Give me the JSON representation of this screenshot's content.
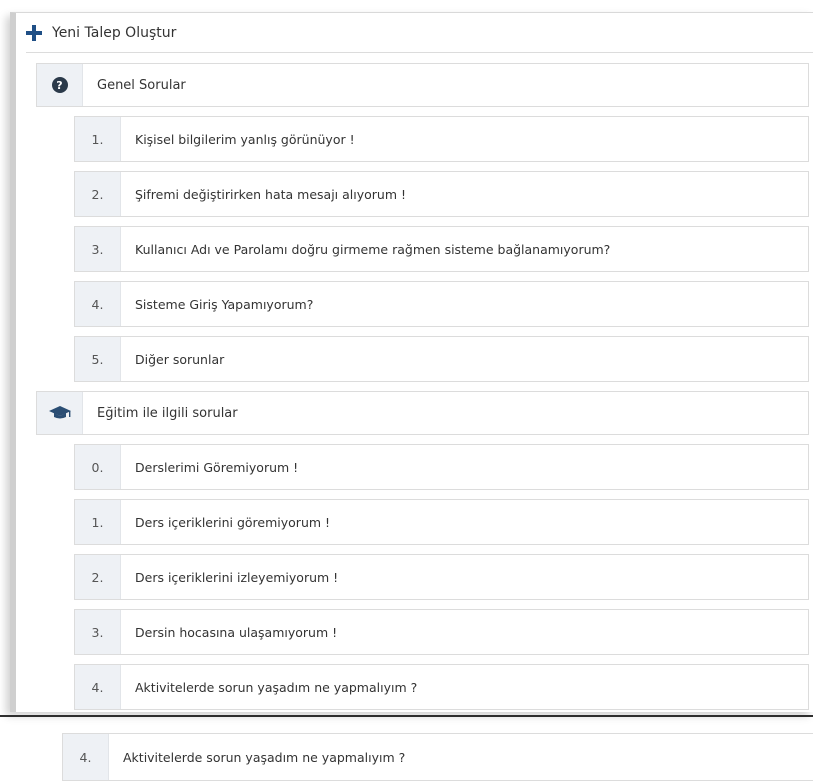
{
  "header": {
    "new_request_label": "Yeni Talep Oluştur"
  },
  "categories": [
    {
      "icon": "question-circle-icon",
      "title": "Genel Sorular",
      "items": [
        {
          "num": "1.",
          "text": "Kişisel bilgilerim yanlış görünüyor !"
        },
        {
          "num": "2.",
          "text": "Şifremi değiştirirken hata mesajı alıyorum !"
        },
        {
          "num": "3.",
          "text": "Kullanıcı Adı ve Parolamı doğru girmeme rağmen sisteme bağlanamıyorum?"
        },
        {
          "num": "4.",
          "text": "Sisteme Giriş Yapamıyorum?"
        },
        {
          "num": "5.",
          "text": "Diğer sorunlar"
        }
      ]
    },
    {
      "icon": "graduation-cap-icon",
      "title": "Eğitim ile ilgili sorular",
      "items": [
        {
          "num": "0.",
          "text": "Derslerimi Göremiyorum !"
        },
        {
          "num": "1.",
          "text": "Ders içeriklerini göremiyorum !"
        },
        {
          "num": "2.",
          "text": "Ders içeriklerini izleyemiyorum !"
        },
        {
          "num": "3.",
          "text": "Dersin hocasına ulaşamıyorum !"
        },
        {
          "num": "4.",
          "text": "Aktivitelerde sorun yaşadım ne yapmalıyım ?"
        }
      ]
    }
  ],
  "zoomed_item": {
    "num": "4.",
    "text": "Aktivitelerde sorun yaşadım ne yapmalıyım ?"
  },
  "colors": {
    "accent": "#1f4f86",
    "cell_bg": "#eef1f5",
    "border": "#dcdcdc"
  }
}
